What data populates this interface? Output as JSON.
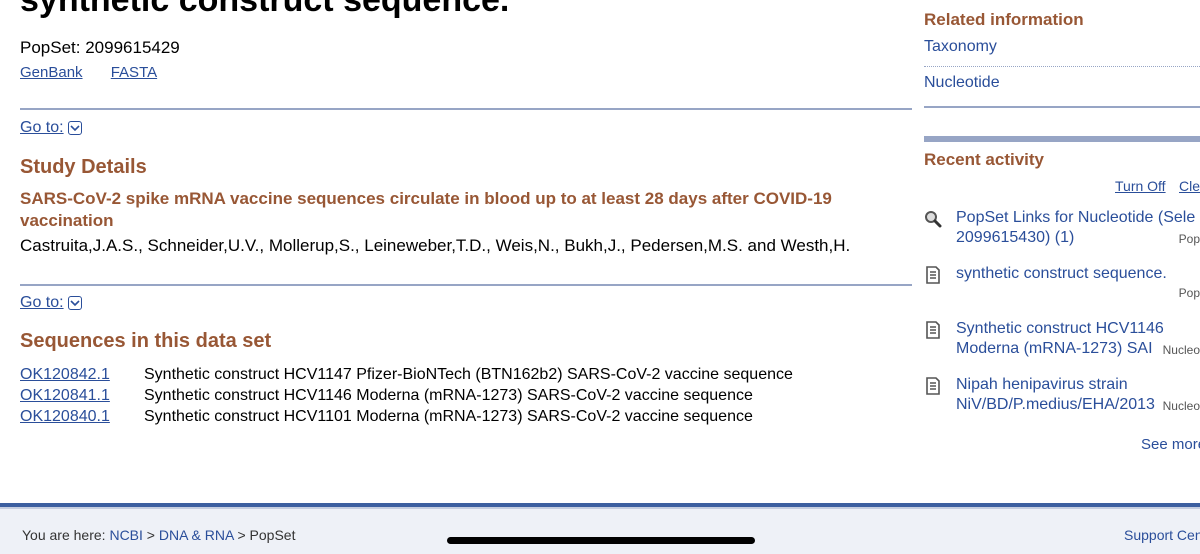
{
  "main": {
    "title": "synthetic construct sequence.",
    "popset_label": "PopSet: 2099615429",
    "formats": [
      "GenBank",
      "FASTA"
    ],
    "goto_label": "Go to:",
    "study_heading": "Study Details",
    "study_title": "SARS-CoV-2 spike mRNA vaccine sequences circulate in blood up to at least 28 days after COVID-19 vaccination",
    "authors": "Castruita,J.A.S., Schneider,U.V., Mollerup,S., Leineweber,T.D., Weis,N., Bukh,J., Pedersen,M.S. and Westh,H.",
    "sequences_heading": "Sequences in this data set",
    "sequences": [
      {
        "accession": "OK120842.1",
        "description": "Synthetic construct HCV1147 Pfizer-BioNTech (BTN162b2) SARS-CoV-2 vaccine sequence"
      },
      {
        "accession": "OK120841.1",
        "description": "Synthetic construct HCV1146 Moderna (mRNA-1273) SARS-CoV-2 vaccine sequence"
      },
      {
        "accession": "OK120840.1",
        "description": "Synthetic construct HCV1101 Moderna (mRNA-1273) SARS-CoV-2 vaccine sequence"
      }
    ]
  },
  "sidebar": {
    "related_heading": "Related information",
    "related_links": [
      "Taxonomy",
      "Nucleotide"
    ],
    "recent_heading": "Recent activity",
    "turn_off": "Turn Off",
    "clear": "Cle",
    "recent_items": [
      {
        "icon": "search-icon",
        "line1": "PopSet Links for Nucleotide (Sele",
        "line2": "2099615430) (1)",
        "db": "Pop"
      },
      {
        "icon": "document-icon",
        "line1": "synthetic construct sequence.",
        "line2": "",
        "db": "Pop"
      },
      {
        "icon": "document-icon",
        "line1": "Synthetic construct HCV1146",
        "line2": "Moderna (mRNA-1273) SAI",
        "db": "Nucleo"
      },
      {
        "icon": "document-icon",
        "line1": "Nipah henipavirus strain",
        "line2": "NiV/BD/P.medius/EHA/2013",
        "db": "Nucleo"
      }
    ],
    "see_more": "See more"
  },
  "footer": {
    "you_are_here": "You are here:",
    "crumbs": [
      "NCBI",
      "DNA & RNA",
      "PopSet"
    ],
    "separator": ">",
    "support": "Support Cen"
  },
  "colors": {
    "heading_brown": "#985735",
    "link_blue": "#2a4e9a",
    "rule_blue": "#97a5c5",
    "footer_blue": "#3c5fa0"
  }
}
